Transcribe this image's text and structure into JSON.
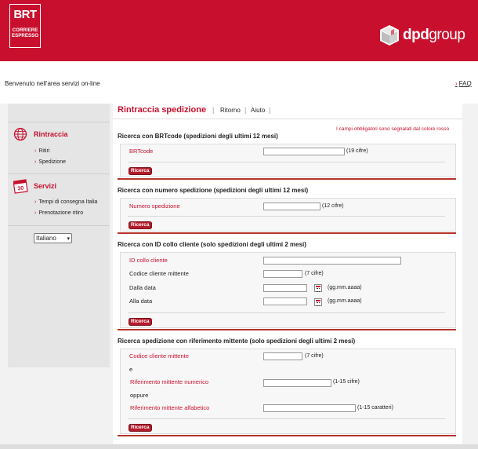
{
  "header": {
    "brt_logo": {
      "mark": "BRT",
      "line1": "CORRIERE",
      "line2": "ESPRESSO"
    },
    "dpd_logo": {
      "part1": "dpd",
      "part2": "group"
    },
    "welcome": "Benvenuto  nell'area servizi on-line",
    "faq": "FAQ"
  },
  "sidebar": {
    "rintraccia": {
      "title": "Rintraccia",
      "items": [
        "Ritiri",
        "Spedizione"
      ]
    },
    "servizi": {
      "title": "Servizi",
      "items": [
        "Tempi di consegna Italia",
        "Prenotazione ritiro"
      ]
    },
    "calendar_day": "30",
    "language": {
      "selected": "Italiano"
    }
  },
  "main": {
    "title": "Rintraccia spedizione",
    "links": {
      "ritorno": "Ritorno",
      "aiuto": "Aiuto"
    },
    "required_note": "I campi obbligatori sono segnalati dal colore rosso",
    "sec1": {
      "title": "Ricerca con BRTcode (spedizioni degli ultimi 12 mesi)",
      "label": "BRTcode",
      "hint": "(19 cifre)",
      "button": "Ricerca"
    },
    "sec2": {
      "title": "Ricerca con numero spedizione (spedizioni degli ultimi 12 mesi)",
      "label": "Numero spedizione",
      "hint": "(12 cifre)",
      "button": "Ricerca"
    },
    "sec3": {
      "title": "Ricerca con ID collo cliente (solo spedizioni degli ultimi 2 mesi)",
      "id_label": "ID collo cliente",
      "codice_label": "Codice cliente mittente",
      "codice_hint": "(7 cifre)",
      "dalla_label": "Dalla data",
      "dalla_hint": "(gg.mm.aaaa)",
      "alla_label": "Alla data",
      "alla_hint": "(gg.mm.aaaa)",
      "button": "Ricerca"
    },
    "sec4": {
      "title": "Ricerca spedizione con riferimento mittente (solo spedizioni degli ultimi 2 mesi)",
      "codice_label": "Codice cliente mittente",
      "codice_hint": "(7 cifre)",
      "e": "e",
      "rif_num_label": "Riferimento mittente numerico",
      "rif_num_hint": "(1-15 cifre)",
      "oppure": "oppure",
      "rif_alf_label": "Riferimento mittente alfabetico",
      "rif_alf_hint": "(1-15 caratteri)",
      "button": "Ricerca"
    }
  },
  "colors": {
    "brand_red": "#c8102e",
    "section_line": "#b5332a",
    "button": "#b31b2c"
  },
  "icons": [
    "globe-icon",
    "calendar-icon",
    "dpd-cube-icon",
    "date-picker-icon",
    "bullet-arrow-icon"
  ]
}
